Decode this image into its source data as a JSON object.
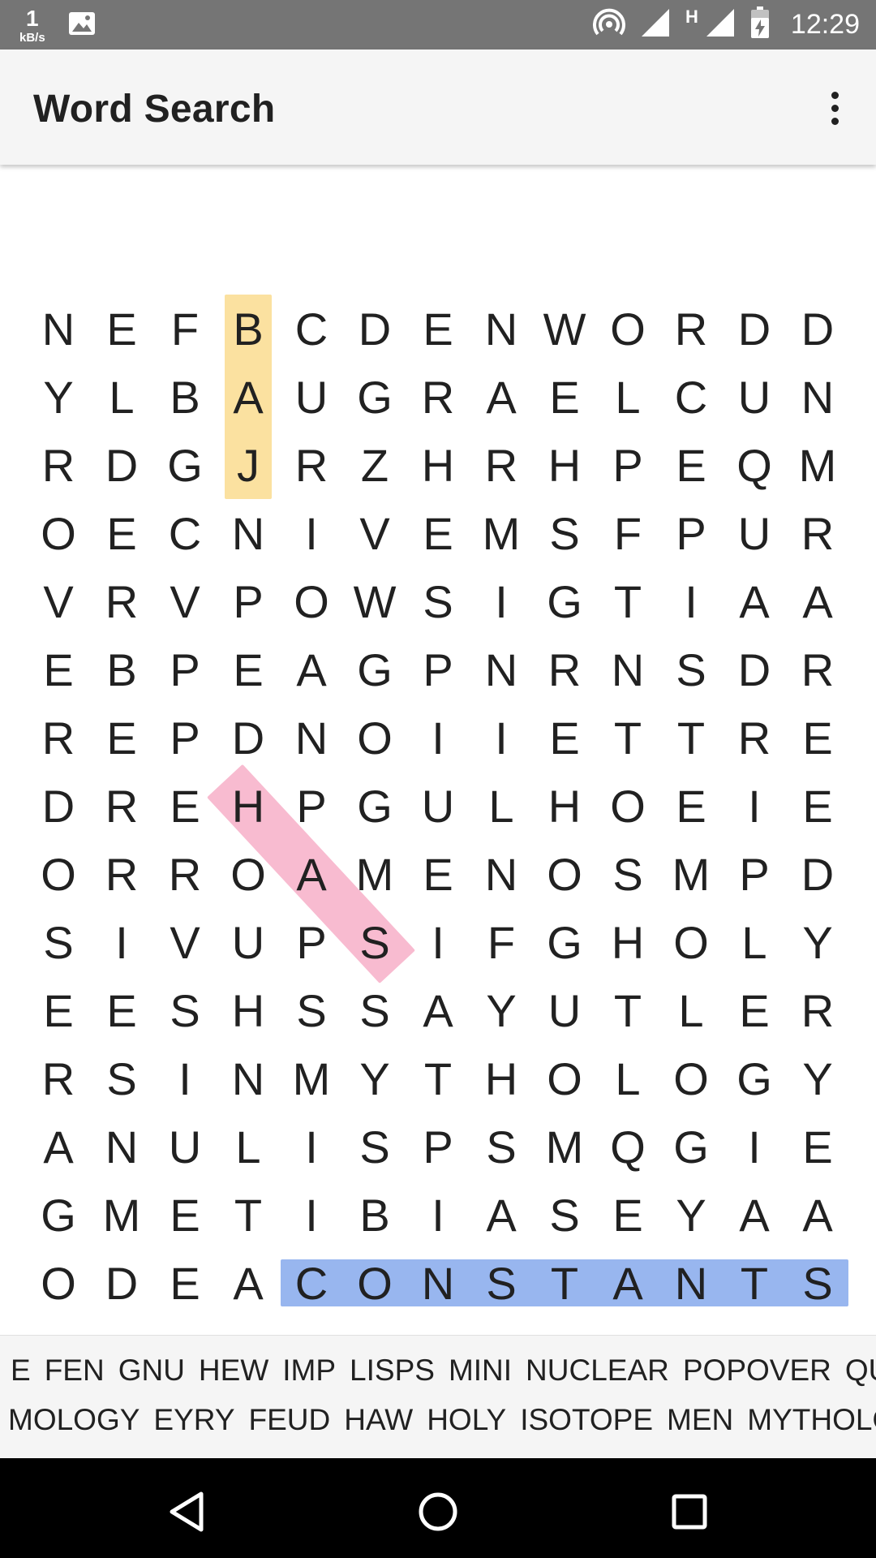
{
  "status_bar": {
    "net_speed_value": "1",
    "net_speed_unit": "kB/s",
    "network_type": "H",
    "time": "12:29",
    "icons": [
      "image-icon",
      "hotspot-icon",
      "signal-icon",
      "signal-icon",
      "battery-charging-icon"
    ]
  },
  "app_bar": {
    "title": "Word Search",
    "menu_icon": "more-vert-icon"
  },
  "grid": {
    "rows": [
      [
        "N",
        "E",
        "F",
        "B",
        "C",
        "D",
        "E",
        "N",
        "W",
        "O",
        "R",
        "D",
        "D"
      ],
      [
        "Y",
        "L",
        "B",
        "A",
        "U",
        "G",
        "R",
        "A",
        "E",
        "L",
        "C",
        "U",
        "N"
      ],
      [
        "R",
        "D",
        "G",
        "J",
        "R",
        "Z",
        "H",
        "R",
        "H",
        "P",
        "E",
        "Q",
        "M"
      ],
      [
        "O",
        "E",
        "C",
        "N",
        "I",
        "V",
        "E",
        "M",
        "S",
        "F",
        "P",
        "U",
        "R"
      ],
      [
        "V",
        "R",
        "V",
        "P",
        "O",
        "W",
        "S",
        "I",
        "G",
        "T",
        "I",
        "A",
        "A"
      ],
      [
        "E",
        "B",
        "P",
        "E",
        "A",
        "G",
        "P",
        "N",
        "R",
        "N",
        "S",
        "D",
        "R"
      ],
      [
        "R",
        "E",
        "P",
        "D",
        "N",
        "O",
        "I",
        "I",
        "E",
        "T",
        "T",
        "R",
        "E"
      ],
      [
        "D",
        "R",
        "E",
        "H",
        "P",
        "G",
        "U",
        "L",
        "H",
        "O",
        "E",
        "I",
        "E"
      ],
      [
        "O",
        "R",
        "R",
        "O",
        "A",
        "M",
        "E",
        "N",
        "O",
        "S",
        "M",
        "P",
        "D"
      ],
      [
        "S",
        "I",
        "V",
        "U",
        "P",
        "S",
        "I",
        "F",
        "G",
        "H",
        "O",
        "L",
        "Y"
      ],
      [
        "E",
        "E",
        "S",
        "H",
        "S",
        "S",
        "A",
        "Y",
        "U",
        "T",
        "L",
        "E",
        "R"
      ],
      [
        "R",
        "S",
        "I",
        "N",
        "M",
        "Y",
        "T",
        "H",
        "O",
        "L",
        "O",
        "G",
        "Y"
      ],
      [
        "A",
        "N",
        "U",
        "L",
        "I",
        "S",
        "P",
        "S",
        "M",
        "Q",
        "G",
        "I",
        "E"
      ],
      [
        "G",
        "M",
        "E",
        "T",
        "I",
        "B",
        "I",
        "A",
        "S",
        "E",
        "Y",
        "A",
        "A"
      ],
      [
        "O",
        "D",
        "E",
        "A",
        "C",
        "O",
        "N",
        "S",
        "T",
        "A",
        "N",
        "T",
        "S"
      ]
    ],
    "highlights": [
      {
        "word": "BAJ",
        "color": "#fbe1a0",
        "from": [
          0,
          3
        ],
        "to": [
          2,
          3
        ]
      },
      {
        "word": "HAS",
        "color": "#f8bbd0",
        "from": [
          7,
          3
        ],
        "to": [
          9,
          5
        ]
      },
      {
        "word": "CONSTANTS",
        "color": "#98b6ef",
        "from": [
          14,
          4
        ],
        "to": [
          14,
          12
        ]
      }
    ]
  },
  "word_list": {
    "row1": [
      "E",
      "FEN",
      "GNU",
      "HEW",
      "IMP",
      "LISPS",
      "MINI",
      "NUCLEAR",
      "POPOVER",
      "QUA"
    ],
    "row2": [
      "MOLOGY",
      "EYRY",
      "FEUD",
      "HAW",
      "HOLY",
      "ISOTOPE",
      "MEN",
      "MYTHOLOG"
    ]
  },
  "nav_bar": {
    "buttons": [
      "back-icon",
      "home-icon",
      "recents-icon"
    ]
  }
}
